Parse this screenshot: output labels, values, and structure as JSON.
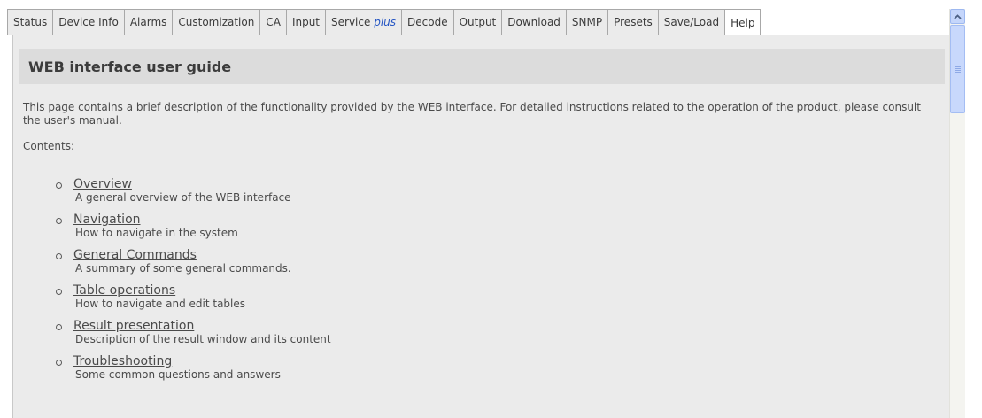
{
  "tabs": [
    {
      "label": "Status",
      "active": false
    },
    {
      "label": "Device Info",
      "active": false
    },
    {
      "label": "Alarms",
      "active": false
    },
    {
      "label": "Customization",
      "active": false
    },
    {
      "label": "CA",
      "active": false
    },
    {
      "label": "Input",
      "active": false
    },
    {
      "label": "Service",
      "suffix": "plus",
      "active": false
    },
    {
      "label": "Decode",
      "active": false
    },
    {
      "label": "Output",
      "active": false
    },
    {
      "label": "Download",
      "active": false
    },
    {
      "label": "SNMP",
      "active": false
    },
    {
      "label": "Presets",
      "active": false
    },
    {
      "label": "Save/Load",
      "active": false
    },
    {
      "label": "Help",
      "active": true
    }
  ],
  "page": {
    "title": "WEB interface user guide",
    "intro": "This page contains a brief description of the functionality provided by the WEB interface. For detailed instructions related to the operation of the product, please consult the user's manual.",
    "contents_label": "Contents:"
  },
  "toc": [
    {
      "title": "Overview",
      "desc": "A general overview of the WEB interface"
    },
    {
      "title": "Navigation",
      "desc": "How to navigate in the system"
    },
    {
      "title": "General Commands",
      "desc": "A summary of some general commands."
    },
    {
      "title": "Table operations",
      "desc": "How to navigate and edit tables"
    },
    {
      "title": "Result presentation",
      "desc": "Description of the result window and its content"
    },
    {
      "title": "Troubleshooting",
      "desc": "Some common questions and answers"
    }
  ],
  "scrollbar": {
    "up_icon": "chevron-up-icon",
    "thumb_icon": "grip-icon"
  },
  "colors": {
    "link": "#4a4a4a",
    "plus_accent": "#2455c3",
    "content_bg": "#ebebeb",
    "title_bar": "#dcdcdc",
    "scroll_accent": "#c8d8fc"
  }
}
